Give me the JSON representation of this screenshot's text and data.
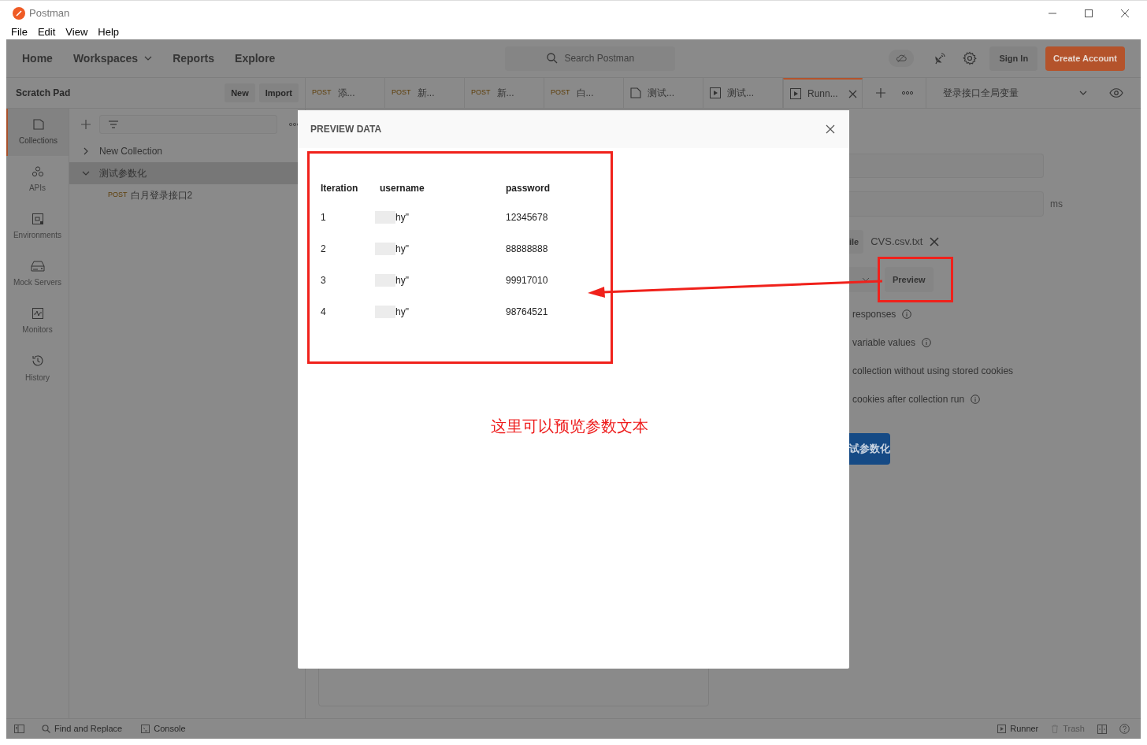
{
  "window": {
    "title": "Postman"
  },
  "menu": [
    "File",
    "Edit",
    "View",
    "Help"
  ],
  "header": {
    "nav": [
      {
        "label": "Home",
        "has_menu": false
      },
      {
        "label": "Workspaces",
        "has_menu": true
      },
      {
        "label": "Reports",
        "has_menu": false
      },
      {
        "label": "Explore",
        "has_menu": false
      }
    ],
    "search": {
      "placeholder": "Search Postman"
    },
    "sign_in": "Sign In",
    "create_account": "Create Account"
  },
  "scratch_pad": {
    "title": "Scratch Pad",
    "buttons": [
      "New",
      "Import"
    ]
  },
  "tabs": [
    {
      "kind": "request",
      "method": "POST",
      "label": "添...",
      "selected": false
    },
    {
      "kind": "request",
      "method": "POST",
      "label": "新...",
      "selected": false
    },
    {
      "kind": "request",
      "method": "POST",
      "label": "新...",
      "selected": false
    },
    {
      "kind": "request",
      "method": "POST",
      "label": "白...",
      "selected": false
    },
    {
      "kind": "collection",
      "label": "测试...",
      "selected": false
    },
    {
      "kind": "runner",
      "label": "测试...",
      "selected": false
    },
    {
      "kind": "runner",
      "label": "Runn...",
      "selected": true
    }
  ],
  "environment": {
    "value": "登录接口全局变量"
  },
  "nav_rail": [
    {
      "kind": "collections",
      "label": "Collections",
      "selected": true
    },
    {
      "kind": "apis",
      "label": "APIs",
      "selected": false
    },
    {
      "kind": "environments",
      "label": "Environments",
      "selected": false
    },
    {
      "kind": "mock",
      "label": "Mock Servers",
      "selected": false
    },
    {
      "kind": "monitors",
      "label": "Monitors",
      "selected": false
    },
    {
      "kind": "history",
      "label": "History",
      "selected": false
    }
  ],
  "tree": [
    {
      "label": "New Collection",
      "expanded": false,
      "selected": false
    },
    {
      "label": "测试参数化",
      "expanded": true,
      "selected": true,
      "children": [
        {
          "method": "POST",
          "label": "白月登录接口2"
        }
      ]
    }
  ],
  "runner": {
    "delay_unit": "ms",
    "file_button": "ile",
    "file_name": "CVS.csv.txt",
    "preview_button": "Preview",
    "options": [
      {
        "label": "responses",
        "info": true
      },
      {
        "label": "variable values",
        "info": true
      },
      {
        "label": "collection without using stored cookies",
        "info": false
      },
      {
        "label": "cookies after collection run",
        "info": true
      }
    ],
    "run_button": "试参数化"
  },
  "modal": {
    "title": "PREVIEW DATA",
    "columns": [
      "Iteration",
      "username",
      "password"
    ],
    "rows": [
      [
        "1",
        "hy\"",
        "12345678"
      ],
      [
        "2",
        "hy\"",
        "88888888"
      ],
      [
        "3",
        "hy\"",
        "99917010"
      ],
      [
        "4",
        "hy\"",
        "98764521"
      ]
    ]
  },
  "annotation": {
    "note": "这里可以预览参数文本"
  },
  "status_bar": {
    "left": [
      {
        "kind": "search",
        "label": "Find and Replace",
        "disabled": false
      },
      {
        "kind": "console",
        "label": "Console",
        "disabled": false
      }
    ],
    "right": [
      {
        "kind": "runner",
        "label": "Runner",
        "disabled": false
      },
      {
        "kind": "trash",
        "label": "Trash",
        "disabled": true
      }
    ]
  }
}
